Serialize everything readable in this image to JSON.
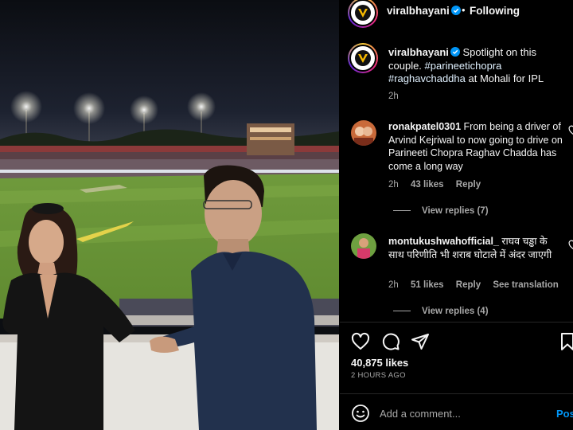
{
  "post": {
    "username": "viralbhayani",
    "follow_status": "Following",
    "separator": "•",
    "verified_icon": "verified-badge-icon",
    "caption_text": "Spotlight on this couple.",
    "hashtags": [
      "#parineetichopra",
      "#raghavchaddha"
    ],
    "caption_tail": "at Mohali for IPL",
    "time": "2h",
    "photo_icon": "stadium-photo"
  },
  "comments": [
    {
      "username": "ronakpatel0301",
      "text": "From being a driver of Arvind Kejriwal to now going to drive on Parineeti Chopra Raghav Chadda has come a long way",
      "time": "2h",
      "likes": "43 likes",
      "reply_label": "Reply",
      "view_replies": "View replies (7)"
    },
    {
      "username": "montukushwahofficial_",
      "text": "राघव चड्ढा के साथ परिणीति भी शराब घोटाले में अंदर जाएगी",
      "time": "2h",
      "likes": "51 likes",
      "reply_label": "Reply",
      "see_translation": "See translation",
      "view_replies": "View replies (4)"
    }
  ],
  "actions": {
    "icons": [
      "heart-icon",
      "comment-icon",
      "share-icon",
      "bookmark-icon"
    ],
    "likes": "40,875 likes",
    "posted": "2 HOURS AGO"
  },
  "composer": {
    "emoji_icon": "emoji-icon",
    "placeholder": "Add a comment...",
    "post_label": "Post"
  },
  "colors": {
    "background": "#000000",
    "secondary_text": "#a8a8a8",
    "link_blue": "#0095f6",
    "hashtag": "#e0f1ff",
    "verified": "#0095f6"
  }
}
